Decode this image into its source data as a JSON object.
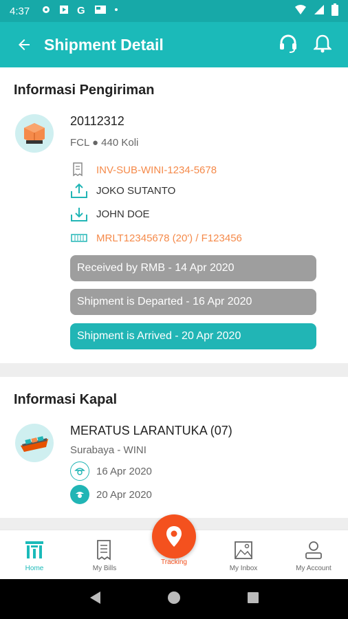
{
  "status_bar": {
    "time": "4:37"
  },
  "app_bar": {
    "title": "Shipment Detail"
  },
  "shipment_info": {
    "section_title": "Informasi Pengiriman",
    "shipment_number": "20112312",
    "summary": "FCL ● 440 Koli",
    "invoice": "INV-SUB-WINI-1234-5678",
    "sender": "JOKO SUTANTO",
    "receiver": "JOHN DOE",
    "container": "MRLT12345678 (20') / F123456",
    "statuses": [
      {
        "label": "Received by RMB - 14 Apr 2020",
        "state": "done",
        "color": "#9e9e9e"
      },
      {
        "label": "Shipment is Departed - 16 Apr 2020",
        "state": "done",
        "color": "#9e9e9e"
      },
      {
        "label": "Shipment is Arrived - 20 Apr 2020",
        "state": "current",
        "color": "#21b5b5"
      }
    ]
  },
  "vessel_info": {
    "section_title": "Informasi Kapal",
    "vessel_name": "MERATUS LARANTUKA (07)",
    "route": "Surabaya - WINI",
    "departure_date": "16 Apr 2020",
    "arrival_date": "20 Apr 2020"
  },
  "bottom_nav": {
    "items": [
      {
        "label": "Home",
        "icon": "home-icon",
        "active": true
      },
      {
        "label": "My Bills",
        "icon": "bills-icon",
        "active": false
      },
      {
        "label": "Tracking",
        "icon": "location-pin-icon",
        "active": false
      },
      {
        "label": "My Inbox",
        "icon": "inbox-icon",
        "active": false
      },
      {
        "label": "My Account",
        "icon": "account-icon",
        "active": false
      }
    ]
  },
  "colors": {
    "primary": "#1bbab9",
    "accent_orange": "#f58a4a",
    "fab": "#f4511e",
    "status_gray": "#9e9e9e",
    "status_teal": "#21b5b5"
  }
}
